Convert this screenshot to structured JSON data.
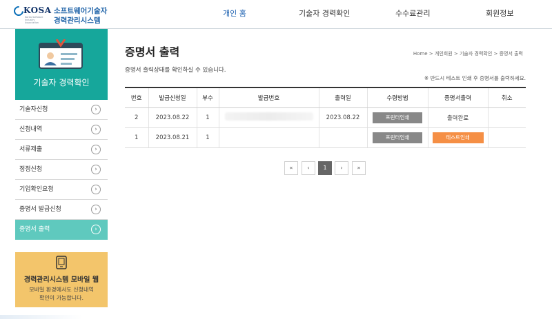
{
  "header": {
    "logo_kosa": "KOSA",
    "logo_sub": "Korea Software Industry Association",
    "logo_line1": "소프트웨어기술자",
    "logo_line2": "경력관리시스템",
    "nav": [
      "개인 홈",
      "기술자 경력확인",
      "수수료관리",
      "회원정보"
    ]
  },
  "sidebar": {
    "title": "기술자 경력확인",
    "items": [
      "기술자신청",
      "신청내역",
      "서류제출",
      "정정신청",
      "기업확인요청",
      "증명서 발급신청",
      "증명서 출력"
    ],
    "active_index": 6,
    "mobile_title": "경력관리시스템 모바일 웹",
    "mobile_desc_line1": "모바일 환경에서도 신청내역",
    "mobile_desc_line2": "확인이 가능합니다."
  },
  "main": {
    "title": "증명서 출력",
    "breadcrumb": "Home > 개인회원 > 기술자 경력확인 > 증명서 출력",
    "description": "증명서 출력상태를 확인하실 수 있습니다.",
    "notice": "※ 반드시 테스트 인쇄 후 증명서를 출력하세요.",
    "columns": [
      "번호",
      "발급신청일",
      "부수",
      "발급번호",
      "출력일",
      "수령방법",
      "증명서출력",
      "취소"
    ],
    "rows": [
      {
        "no": "2",
        "apply_date": "2023.08.22",
        "copies": "1",
        "issue_no": "",
        "print_date": "2023.08.22",
        "method": "프린터인쇄",
        "status": "출력완료",
        "cancel": ""
      },
      {
        "no": "1",
        "apply_date": "2023.08.21",
        "copies": "1",
        "issue_no": "",
        "print_date": "",
        "method": "프린터인쇄",
        "status": "테스트인쇄",
        "cancel": ""
      }
    ]
  },
  "pagination": {
    "first": "«",
    "prev": "‹",
    "current": "1",
    "next": "›",
    "last": "»"
  },
  "colors": {
    "teal": "#16a79b",
    "active_menu": "#5fc9be",
    "mobile_box": "#f3c56b",
    "test_button": "#f58f45",
    "print_button": "#888888",
    "nav_active": "#1a5fb0"
  }
}
